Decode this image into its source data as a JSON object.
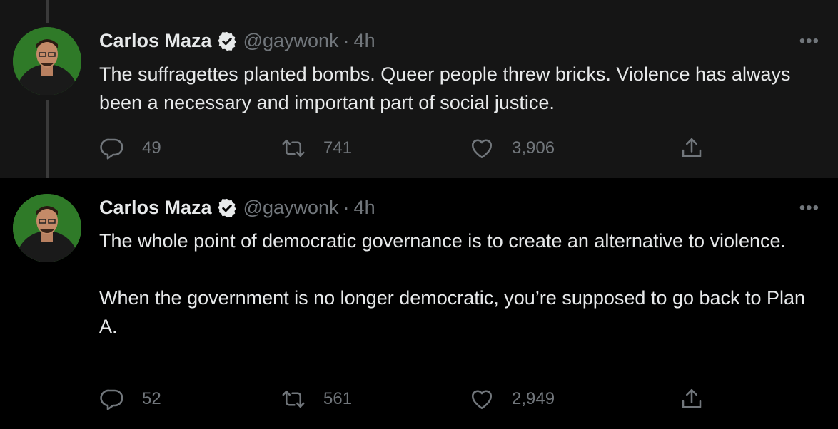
{
  "colors": {
    "background": "#000000",
    "highlight_background": "#151515",
    "text_primary": "#e7e9ea",
    "text_secondary": "#71767b",
    "thread_line": "#3a3a3a"
  },
  "tweets": [
    {
      "author_name": "Carlos Maza",
      "handle": "@gaywonk",
      "separator": "·",
      "time": "4h",
      "more_label": "•••",
      "text": [
        "The suffragettes planted bombs. Queer people threw bricks. Violence has always been a necessary and important part of social justice."
      ],
      "replies": "49",
      "retweets": "741",
      "likes": "3,906",
      "icons": [
        "reply-icon",
        "retweet-icon",
        "like-icon",
        "share-icon",
        "verified-badge-icon"
      ]
    },
    {
      "author_name": "Carlos Maza",
      "handle": "@gaywonk",
      "separator": "·",
      "time": "4h",
      "more_label": "•••",
      "text": [
        "The whole point of democratic governance is to create an alternative to violence.",
        "When the government is no longer democratic, you’re supposed to go back to Plan A."
      ],
      "replies": "52",
      "retweets": "561",
      "likes": "2,949",
      "icons": [
        "reply-icon",
        "retweet-icon",
        "like-icon",
        "share-icon",
        "verified-badge-icon"
      ]
    }
  ]
}
